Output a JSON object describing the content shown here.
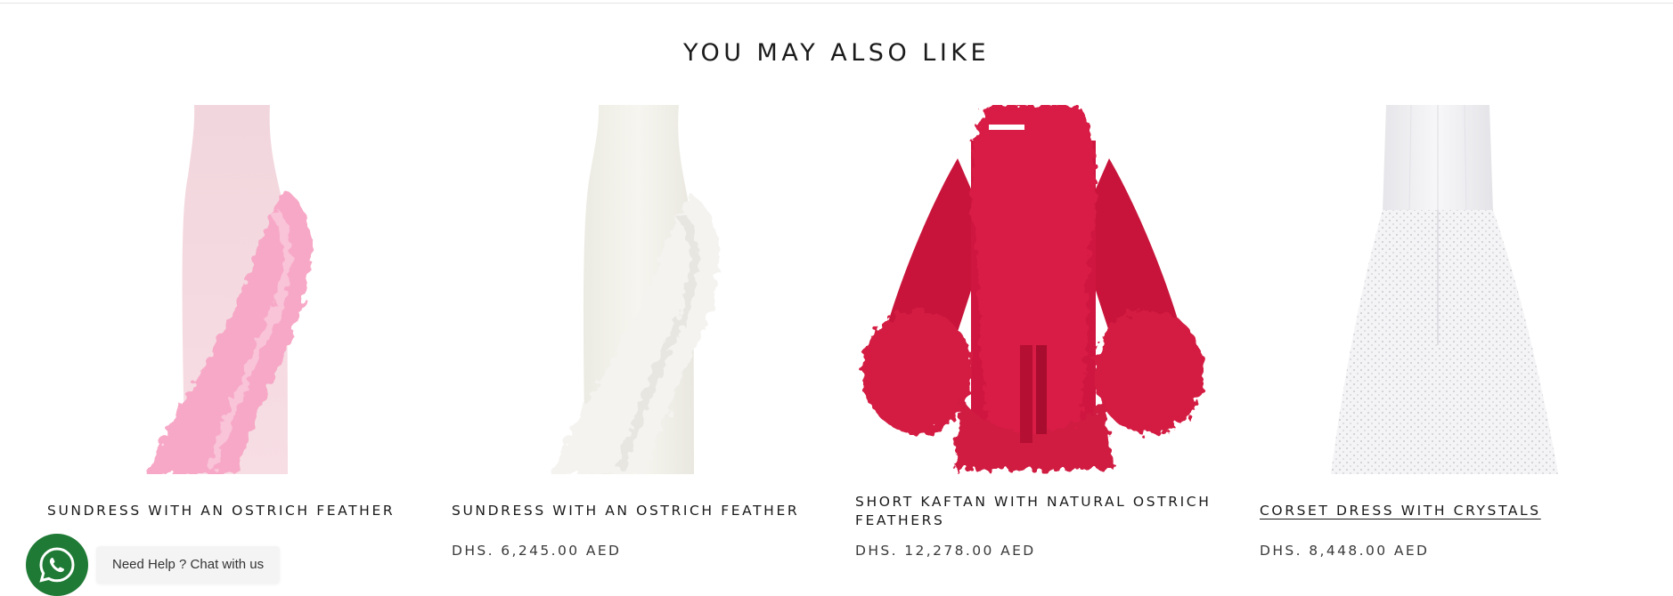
{
  "section": {
    "title": "YOU MAY ALSO LIKE"
  },
  "products": [
    {
      "name": "SUNDRESS WITH AN OSTRICH FEATHER",
      "price": "",
      "image_icon": "pink-feather-dress-image",
      "accent_color": "#f5a9c8"
    },
    {
      "name": "SUNDRESS WITH AN OSTRICH FEATHER",
      "price": "DHS. 6,245.00 AED",
      "image_icon": "white-feather-dress-image",
      "accent_color": "#f1efe9"
    },
    {
      "name": "SHORT KAFTAN WITH NATURAL OSTRICH FEATHERS",
      "price": "DHS. 12,278.00 AED",
      "image_icon": "red-feather-kaftan-image",
      "accent_color": "#d3123a"
    },
    {
      "name": "CORSET DRESS WITH CRYSTALS",
      "price": "DHS. 8,448.00 AED",
      "image_icon": "white-crystal-corset-dress-image",
      "accent_color": "#e9e9ec"
    }
  ],
  "chat_widget": {
    "label": "Need Help ? Chat with us",
    "icon": "whatsapp-icon",
    "color": "#1f7a35"
  }
}
